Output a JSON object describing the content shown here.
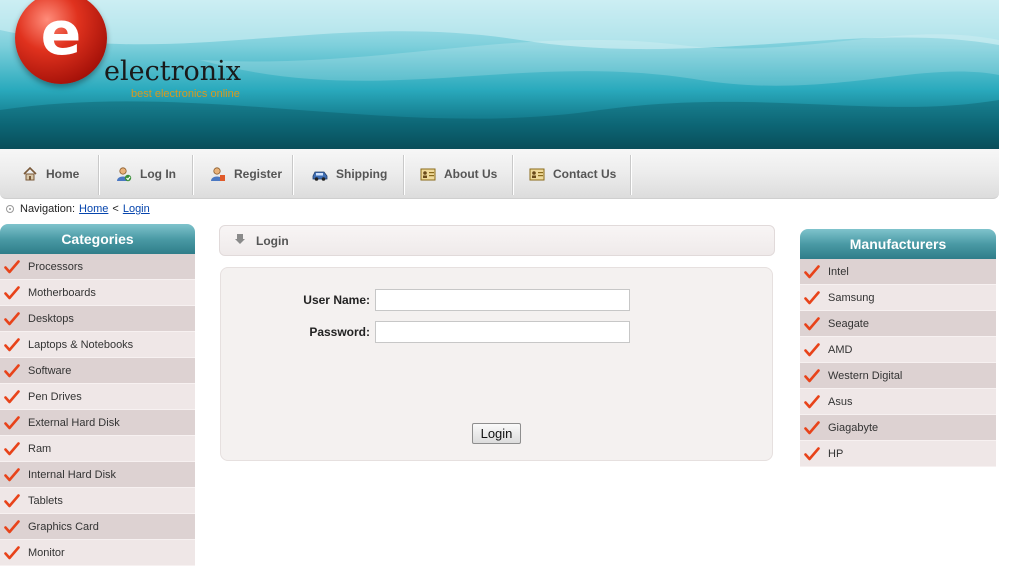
{
  "header": {
    "logo_letter": "e",
    "logo_name": "electronix",
    "logo_tagline": "best electronics online"
  },
  "nav": {
    "items": [
      {
        "label": "Home",
        "icon": "home-icon"
      },
      {
        "label": "Log In",
        "icon": "user-login-icon"
      },
      {
        "label": "Register",
        "icon": "user-register-icon"
      },
      {
        "label": "Shipping",
        "icon": "car-icon"
      },
      {
        "label": "About Us",
        "icon": "contact-card-icon"
      },
      {
        "label": "Contact Us",
        "icon": "contact-card-icon"
      }
    ]
  },
  "breadcrumb": {
    "prefix": "Navigation:",
    "home": "Home",
    "separator": "<",
    "current": "Login"
  },
  "categories": {
    "title": "Categories",
    "items": [
      "Processors",
      "Motherboards",
      "Desktops",
      "Laptops & Notebooks",
      "Software",
      "Pen Drives",
      "External Hard Disk",
      "Ram",
      "Internal Hard Disk",
      "Tablets",
      "Graphics Card",
      "Monitor"
    ]
  },
  "manufacturers": {
    "title": "Manufacturers",
    "items": [
      "Intel",
      "Samsung",
      "Seagate",
      "AMD",
      "Western Digital",
      "Asus",
      "Giagabyte",
      "HP"
    ]
  },
  "login": {
    "heading": "Login",
    "username_label": "User Name:",
    "username_value": "",
    "password_label": "Password:",
    "password_value": "",
    "button_label": "Login"
  },
  "colors": {
    "sidebar_head": "#4a9aa5",
    "list_odd": "#ddd2d2",
    "list_even": "#efe7e7",
    "check": "#e8431a",
    "link": "#0645ad"
  }
}
